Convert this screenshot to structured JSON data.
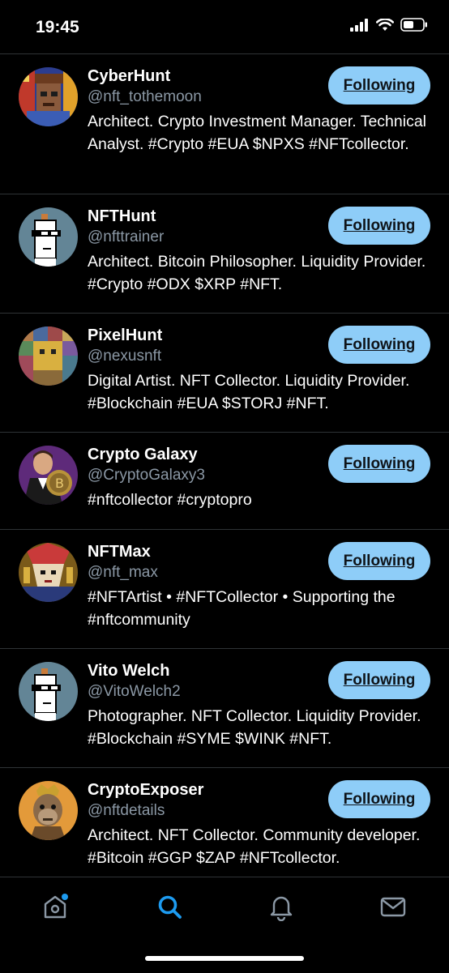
{
  "status_bar": {
    "time": "19:45"
  },
  "accounts": [
    {
      "name": "CyberHunt",
      "handle": "@nft_tothemoon",
      "bio": "Architect. Crypto Investment Manager. Technical Analyst. #Crypto #EUA $NPXS #NFTcollector.",
      "button": "Following"
    },
    {
      "name": "NFTHunt",
      "handle": "@nfttrainer",
      "bio": "Architect. Bitcoin Philosopher. Liquidity Provider. #Crypto #ODX $XRP #NFT.",
      "button": "Following"
    },
    {
      "name": "PixelHunt",
      "handle": "@nexusnft",
      "bio": "Digital Artist. NFT Collector. Liquidity Provider. #Blockchain #EUA $STORJ #NFT.",
      "button": "Following"
    },
    {
      "name": "Crypto Galaxy",
      "handle": "@CryptoGalaxy3",
      "bio": "#nftcollector #cryptopro",
      "button": "Following"
    },
    {
      "name": "NFTMax",
      "handle": "@nft_max",
      "bio": "#NFTArtist • #NFTCollector • Supporting the #nftcommunity",
      "button": "Following"
    },
    {
      "name": "Vito Welch",
      "handle": "@VitoWelch2",
      "bio": "Photographer. NFT Collector. Liquidity Provider. #Blockchain #SYME $WINK #NFT.",
      "button": "Following"
    },
    {
      "name": "CryptoExposer",
      "handle": "@nftdetails",
      "bio": "Architect. NFT Collector. Community developer. #Bitcoin #GGP $ZAP #NFTcollector.",
      "button": "Following"
    }
  ],
  "tab_bar": {
    "tabs": [
      "home-icon",
      "search-icon",
      "notifications-icon",
      "messages-icon"
    ],
    "active": "search-icon"
  },
  "colors": {
    "accent": "#1d9bf0",
    "button_bg": "#8ecdf8",
    "muted": "#8b98a5",
    "divider": "#2f3336"
  }
}
